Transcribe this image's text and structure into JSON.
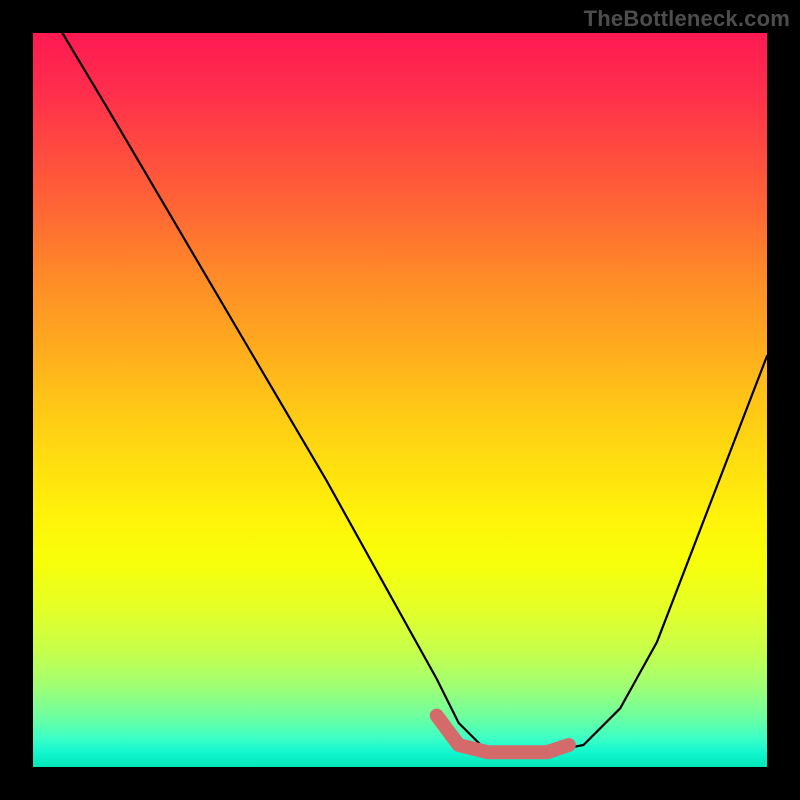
{
  "watermark": "TheBottleneck.com",
  "chart_data": {
    "type": "line",
    "title": "",
    "xlabel": "",
    "ylabel": "",
    "xlim": [
      0,
      100
    ],
    "ylim": [
      0,
      100
    ],
    "series": [
      {
        "name": "bottleneck-curve",
        "x": [
          4,
          10,
          20,
          30,
          40,
          50,
          55,
          58,
          62,
          66,
          70,
          75,
          80,
          85,
          90,
          95,
          100
        ],
        "values": [
          100,
          90,
          73,
          56,
          39,
          21,
          12,
          6,
          2,
          2,
          2,
          3,
          8,
          17,
          30,
          43,
          56
        ]
      }
    ],
    "highlight": {
      "name": "optimal-range",
      "x": [
        55,
        58,
        62,
        66,
        70,
        73
      ],
      "values": [
        7,
        3,
        2,
        2,
        2,
        3
      ]
    },
    "gradient_stops": [
      {
        "pos": 0,
        "color": "#ff1a52"
      },
      {
        "pos": 50,
        "color": "#ffc417"
      },
      {
        "pos": 100,
        "color": "#00e6b8"
      }
    ]
  }
}
